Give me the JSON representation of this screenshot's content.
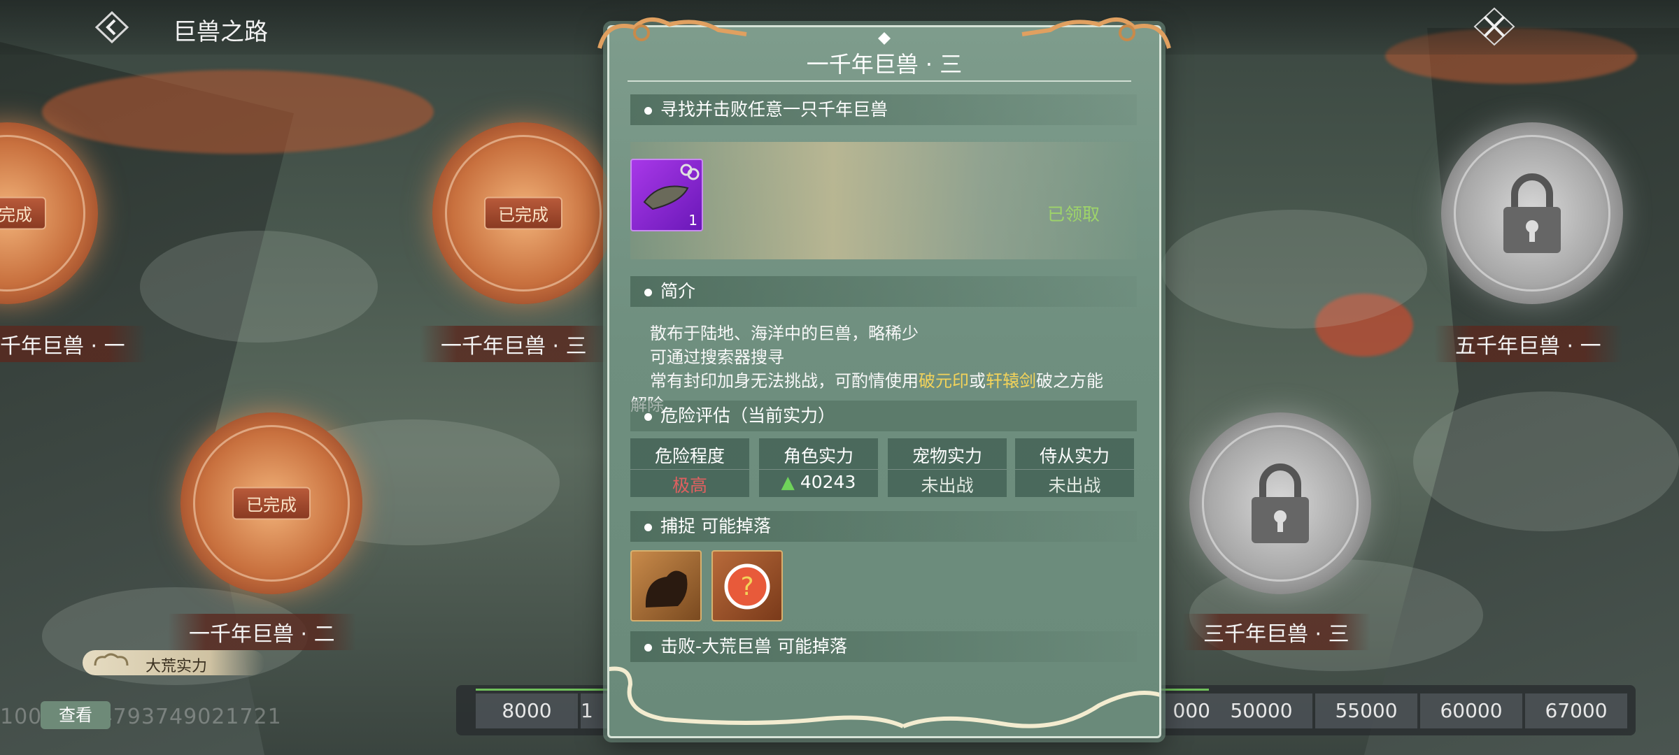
{
  "header": {
    "title": "巨兽之路"
  },
  "nodes": [
    {
      "label": "一千年巨兽 · 一",
      "badge": "已完成",
      "state": "done"
    },
    {
      "label": "一千年巨兽 · 三",
      "badge": "已完成",
      "state": "done"
    },
    {
      "label": "一千年巨兽 · 二",
      "badge": "已完成",
      "state": "done"
    },
    {
      "label": "五千年巨兽 · 一",
      "state": "locked"
    },
    {
      "label": "三千年巨兽 · 三",
      "state": "locked"
    }
  ],
  "power_tag": "大荒实力",
  "view_button": "查看",
  "id_text": "1003 3 84793749021721",
  "milestones": [
    "8000",
    "1",
    "000",
    "50000",
    "55000",
    "60000",
    "67000"
  ],
  "panel": {
    "title": "一千年巨兽 · 三",
    "task": "寻找并击败任意一只千年巨兽",
    "reward": {
      "count": "1",
      "status": "已领取"
    },
    "intro_head": "简介",
    "intro_lines": [
      "散布于陆地、海洋中的巨兽，略稀少",
      "可通过搜索器搜寻"
    ],
    "intro_line3": {
      "pre": "常有封印加身无法挑战，可酌情使用",
      "hl1": "破元印",
      "mid": "或",
      "hl2": "轩辕剑",
      "post": "破之方能"
    },
    "intro_line4": "解除",
    "danger_head": "危险评估（当前实力）",
    "stats": [
      {
        "label": "危险程度",
        "value": "极高"
      },
      {
        "label": "角色实力",
        "value": "40243"
      },
      {
        "label": "宠物实力",
        "value": "未出战"
      },
      {
        "label": "侍从实力",
        "value": "未出战"
      }
    ],
    "capture_head": "捕捉 可能掉落",
    "defeat_head": "击败-大荒巨兽 可能掉落"
  },
  "colors": {
    "danger": "#e06060",
    "up_arrow": "#6fd35a",
    "highlight": "#f3d35a",
    "claimed": "#9ed46a"
  }
}
